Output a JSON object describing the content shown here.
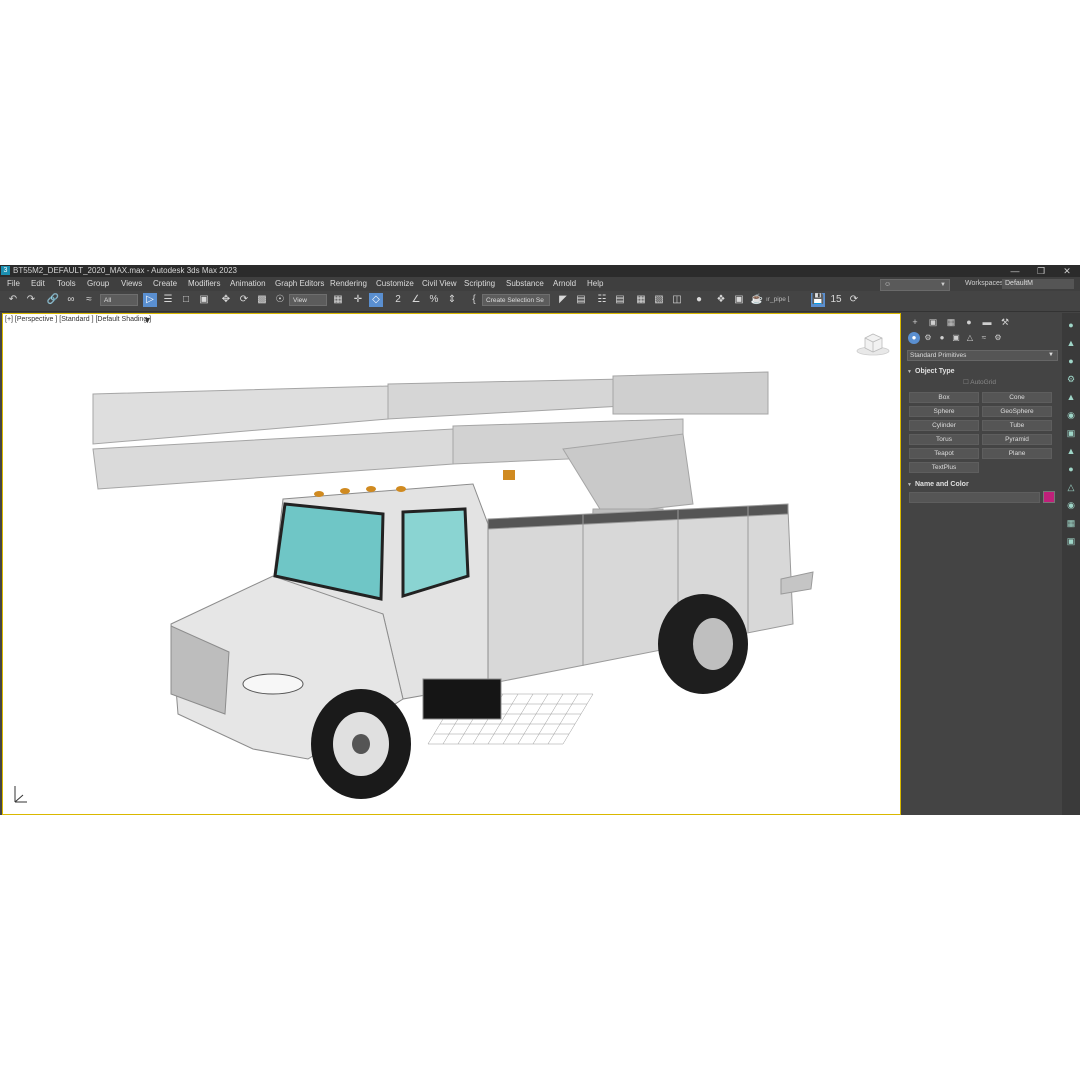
{
  "window": {
    "app_icon": "3",
    "title": "BT55M2_DEFAULT_2020_MAX.max - Autodesk 3ds Max 2023",
    "minimize_label": "—",
    "maximize_label": "❐",
    "close_label": "✕"
  },
  "menu": {
    "items": [
      "File",
      "Edit",
      "Tools",
      "Group",
      "Views",
      "Create",
      "Modifiers",
      "Animation",
      "Graph Editors",
      "Rendering",
      "Customize",
      "Civil View",
      "Scripting",
      "Substance",
      "Arnold",
      "Help"
    ],
    "signin_icon": "user-icon",
    "workspaces_label": "Workspaces:",
    "workspace_value": "DefaultM"
  },
  "toolbar": {
    "selection_filter": "All",
    "ref_coord": "View",
    "named_selection": "Create Selection Se",
    "ui_text": "ır_pipe ⌊",
    "frame_badge": "15"
  },
  "viewport": {
    "label": "[+] [Perspective ] [Standard ] [Default Shading ]",
    "filter_icon": "funnel-icon",
    "border_color": "#d9b800"
  },
  "command_panel": {
    "category": "Standard Primitives",
    "object_type_title": "Object Type",
    "autogrid_label": "AutoGrid",
    "primitives": [
      "Box",
      "Cone",
      "Sphere",
      "GeoSphere",
      "Cylinder",
      "Tube",
      "Torus",
      "Pyramid",
      "Teapot",
      "Plane",
      "TextPlus"
    ],
    "name_color_title": "Name and Color",
    "object_color": "#c0207a"
  },
  "colors": {
    "ui_dark": "#444444",
    "accent": "#5a8fd0",
    "selection_border": "#d9b800"
  }
}
